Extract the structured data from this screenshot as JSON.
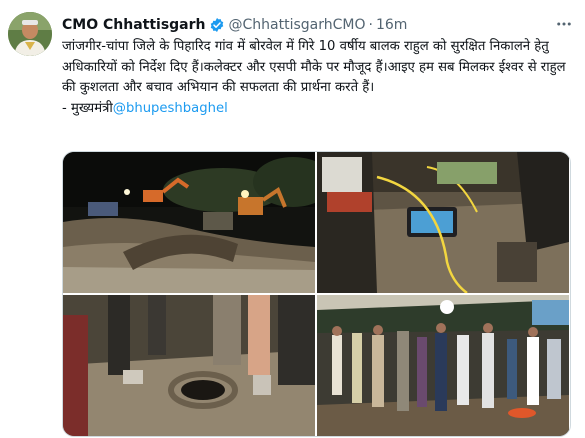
{
  "author": {
    "display_name": "CMO Chhattisgarh",
    "handle": "@ChhattisgarhCMO",
    "separator": "·",
    "time": "16m"
  },
  "tweet": {
    "text": "जांजगीर-चांपा जिले के पिहारिद गांव में बोरवेल में गिरे 10 वर्षीय बालक राहुल को सुरक्षित निकालने हेतु अधिकारियों को निर्देश दिए हैं।कलेक्टर और एसपी मौके पर मौजूद हैं।आइए हम सब मिलकर ईश्वर से राहुल की कुशलता और बचाव अभियान की सफलता की प्रार्थना करते हैं।",
    "signature_prefix": "- मुख्यमंत्री",
    "signature_mention": "@bhupeshbaghel"
  },
  "icons": {
    "verified": "verified-badge-icon",
    "more": "more-options-icon"
  },
  "colors": {
    "accent": "#1d9bf0",
    "secondary_text": "#536471"
  }
}
